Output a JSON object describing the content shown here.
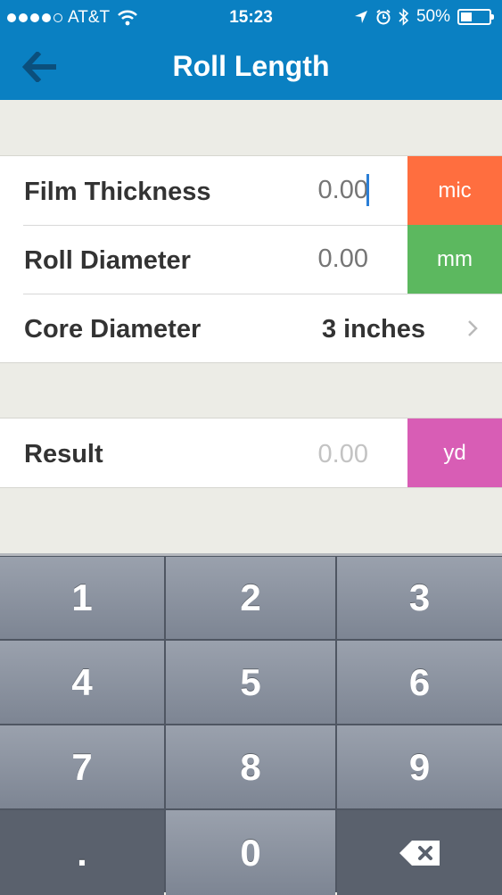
{
  "status_bar": {
    "carrier": "AT&T",
    "time": "15:23",
    "battery": "50%"
  },
  "nav": {
    "title": "Roll Length"
  },
  "form": {
    "film_thickness": {
      "label": "Film Thickness",
      "placeholder": "0.00",
      "unit": "mic",
      "unit_color": "#ff6e3f"
    },
    "roll_diameter": {
      "label": "Roll Diameter",
      "placeholder": "0.00",
      "unit": "mm",
      "unit_color": "#5cb85f"
    },
    "core_diameter": {
      "label": "Core Diameter",
      "value": "3 inches"
    }
  },
  "result": {
    "label": "Result",
    "value": "0.00",
    "unit": "yd",
    "unit_color": "#d85db5"
  },
  "keypad": {
    "keys": [
      "1",
      "2",
      "3",
      "4",
      "5",
      "6",
      "7",
      "8",
      "9",
      ".",
      "0"
    ],
    "delete_icon": "backspace-icon"
  }
}
